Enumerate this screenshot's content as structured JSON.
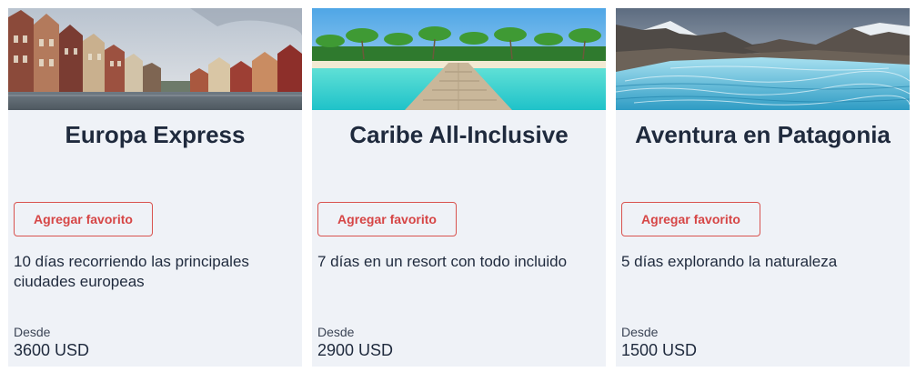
{
  "tours": [
    {
      "title": "Europa Express",
      "image": "european-canal-town-photo",
      "favorite_label": "Agregar favorito",
      "description": "10 días recorriendo las principales ciudades europeas",
      "price_label": "Desde",
      "price": "3600 USD"
    },
    {
      "title": "Caribe All-Inclusive",
      "image": "caribbean-pier-beach-photo",
      "favorite_label": "Agregar favorito",
      "description": "7 días en un resort con todo incluido",
      "price_label": "Desde",
      "price": "2900 USD"
    },
    {
      "title": "Aventura en Patagonia",
      "image": "patagonia-glacier-photo",
      "favorite_label": "Agregar favorito",
      "description": "5 días explorando la naturaleza",
      "price_label": "Desde",
      "price": "1500 USD"
    }
  ],
  "colors": {
    "card_background": "#eff2f7",
    "title_text": "#1f2a3d",
    "favorite_accent": "#d64545"
  }
}
